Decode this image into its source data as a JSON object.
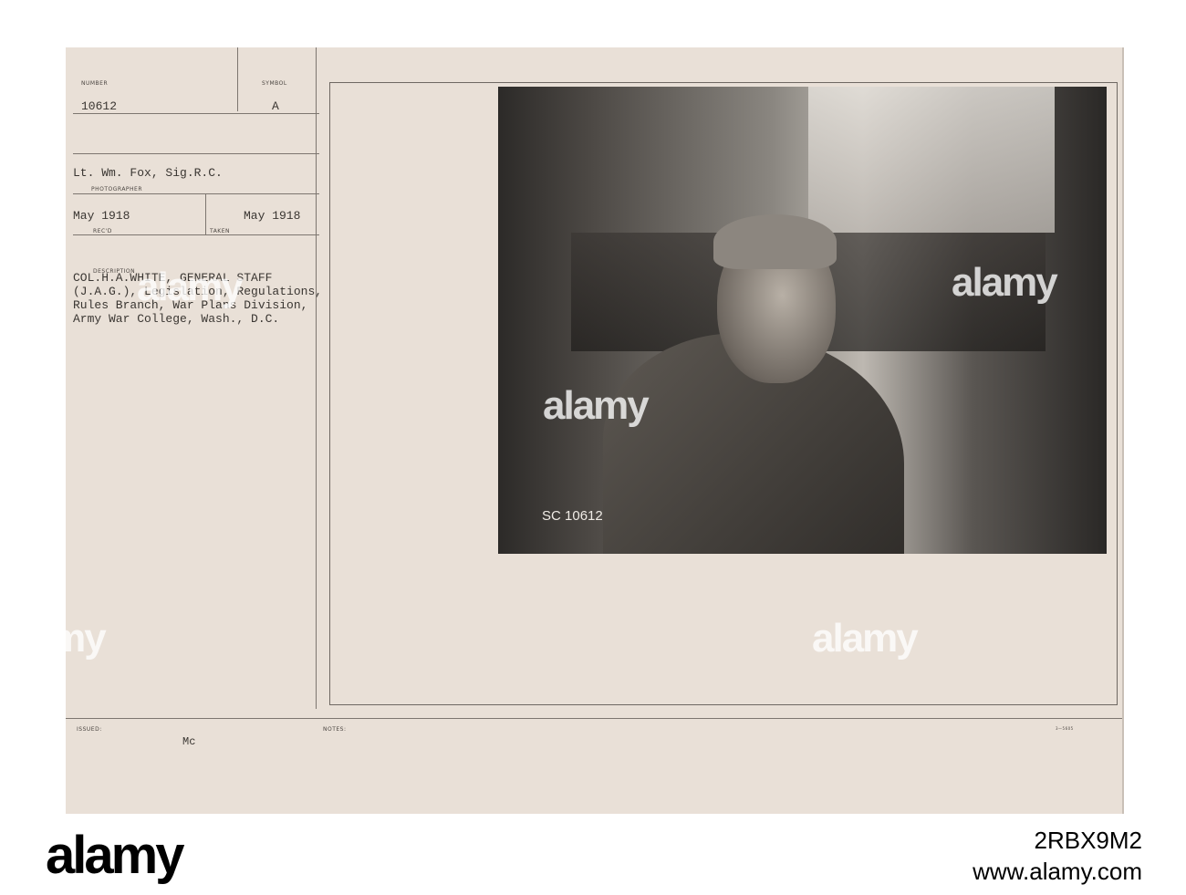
{
  "card": {
    "number_label": "NUMBER",
    "number": "10612",
    "symbol_label": "SYMBOL",
    "symbol": "A",
    "photographer": "Lt. Wm. Fox, Sig.R.C.",
    "photographer_label": "PHOTOGRAPHER",
    "received": "May 1918",
    "received_label": "REC'D",
    "taken": "May 1918",
    "taken_label": "TAKEN",
    "description_label": "DESCRIPTION",
    "description": "COL.H.A.WHITE, GENERAL STAFF\n(J.A.G.), Legislation, Regulations,\nRules Branch, War Plans Division,\nArmy War College, Wash., D.C.",
    "issued_label": "ISSUED:",
    "issued": "Mc",
    "notes_label": "NOTES:",
    "form_number": "3—5605"
  },
  "photo": {
    "negative_mark": "SC 10612"
  },
  "watermark": {
    "text": "alamy"
  },
  "banner": {
    "logo": "alamy",
    "image_id": "2RBX9M2",
    "url": "www.alamy.com"
  }
}
